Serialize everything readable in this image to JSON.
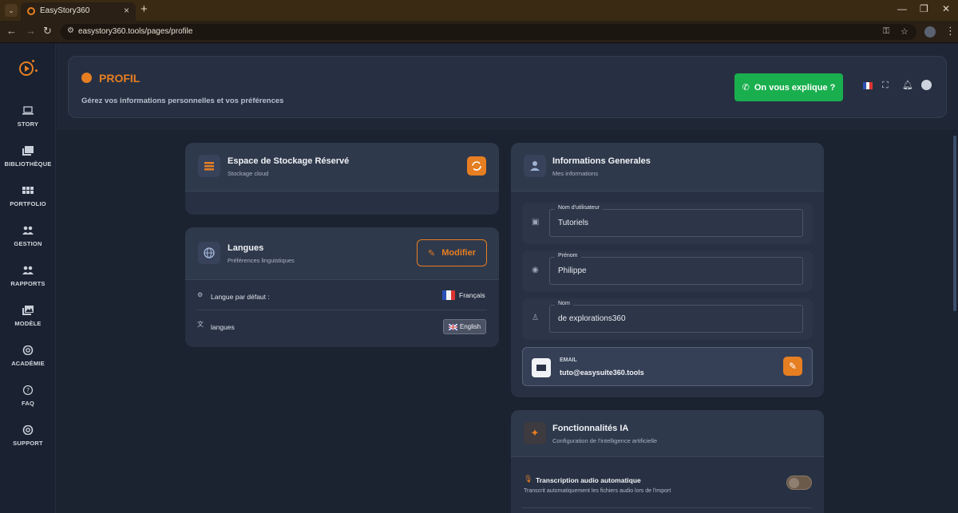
{
  "browser": {
    "tab_title": "EasyStory360",
    "url": "easystory360.tools/pages/profile"
  },
  "sidebar": {
    "items": [
      {
        "label": "STORY",
        "icon": "laptop-icon"
      },
      {
        "label": "BIBLIOTHÈQUE",
        "icon": "library-icon"
      },
      {
        "label": "PORTFOLIO",
        "icon": "grid-icon"
      },
      {
        "label": "GESTION",
        "icon": "users-icon"
      },
      {
        "label": "RAPPORTS",
        "icon": "users-icon"
      },
      {
        "label": "MODÈLE",
        "icon": "images-icon"
      },
      {
        "label": "ACADÉMIE",
        "icon": "lifebuoy-icon"
      },
      {
        "label": "FAQ",
        "icon": "help-icon"
      },
      {
        "label": "SUPPORT",
        "icon": "lifebuoy-icon"
      }
    ]
  },
  "header": {
    "title": "PROFIL",
    "subtitle": "Gérez vos informations personnelles et vos préférences",
    "explain_button": "On vous explique ?"
  },
  "storage": {
    "title": "Espace de Stockage Réservé",
    "subtitle": "Stockage cloud"
  },
  "languages": {
    "title": "Langues",
    "subtitle": "Préférences linguistiques",
    "modify_button": "Modifier",
    "default_label": "Langue par défaut :",
    "default_value": "Français",
    "langs_label": "langues",
    "langs_badge": "English"
  },
  "general": {
    "title": "Informations Generales",
    "subtitle": "Mes informations",
    "username_label": "Nom d'utilisateur",
    "username_value": "Tutoriels",
    "firstname_label": "Prénom",
    "firstname_value": "Philippe",
    "lastname_label": "Nom",
    "lastname_value": "de explorations360",
    "email_label": "EMAIL",
    "email_value": "tuto@easysuite360.tools"
  },
  "ai": {
    "title": "Fonctionnalités IA",
    "subtitle": "Configuration de l'intelligence artificielle",
    "transcription_title": "Transcription audio automatique",
    "transcription_desc": "Transcrit automatiquement les fichiers audio lors de l'import",
    "transcription_enabled": false
  },
  "colors": {
    "accent": "#e67e22",
    "success": "#1aaf4e",
    "background": "#1b2330"
  }
}
